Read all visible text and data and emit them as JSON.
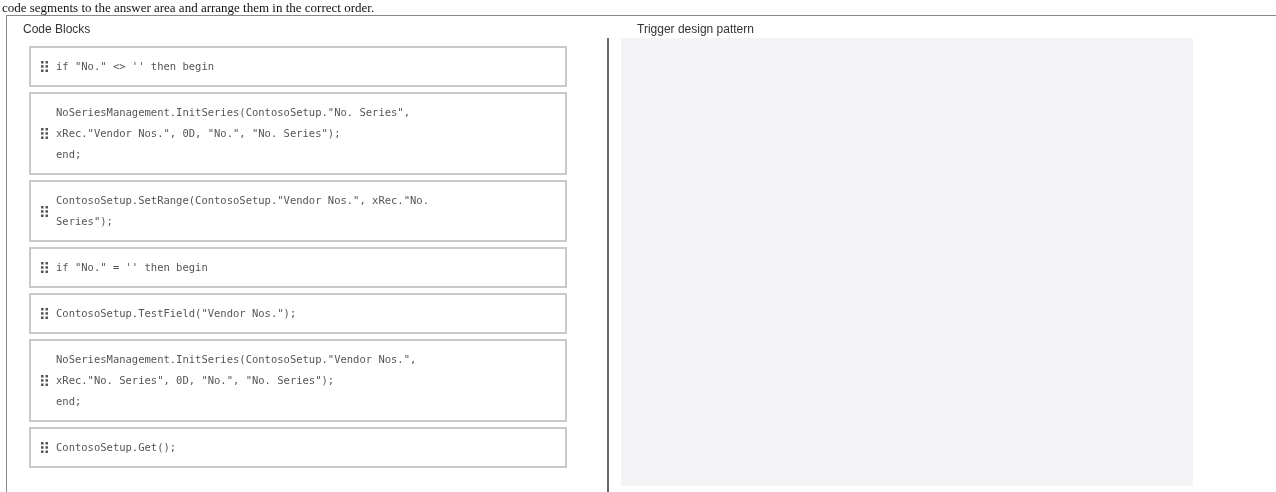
{
  "instruction": "code segments to the answer area and arrange them in the correct order.",
  "code_blocks": {
    "title": "Code Blocks",
    "items": [
      {
        "code": "if \"No.\" <> '' then begin"
      },
      {
        "code": "NoSeriesManagement.InitSeries(ContosoSetup.\"No. Series\",\nxRec.\"Vendor Nos.\", 0D, \"No.\", \"No. Series\");\nend;"
      },
      {
        "code": "ContosoSetup.SetRange(ContosoSetup.\"Vendor Nos.\", xRec.\"No.\nSeries\");"
      },
      {
        "code": "if \"No.\" = '' then begin"
      },
      {
        "code": "ContosoSetup.TestField(\"Vendor Nos.\");"
      },
      {
        "code": "NoSeriesManagement.InitSeries(ContosoSetup.\"Vendor Nos.\",\nxRec.\"No. Series\", 0D, \"No.\", \"No. Series\");\nend;"
      },
      {
        "code": "ContosoSetup.Get();"
      }
    ]
  },
  "answer_area": {
    "title": "Trigger design pattern"
  }
}
